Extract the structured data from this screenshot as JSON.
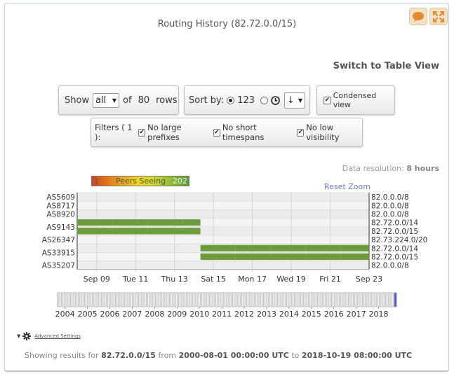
{
  "title": "Routing History (82.72.0.0/15)",
  "icons": {
    "comment": "speech-bubble-icon",
    "expand": "expand-icon",
    "gear": "gear-icon"
  },
  "switch_link": "Switch to Table View",
  "rows_control": {
    "show_label": "Show",
    "selected": "all",
    "of_label": "of",
    "count": "80",
    "rows_label": "rows"
  },
  "sort_control": {
    "label": "Sort by:",
    "numeric_label": "123",
    "selected": "123",
    "order": "↓"
  },
  "condensed": {
    "label": "Condensed view",
    "checked": true
  },
  "filters": {
    "label": "Filters ( 1 ):",
    "items": [
      {
        "label": "No large prefixes",
        "checked": true
      },
      {
        "label": "No short timespans",
        "checked": true
      },
      {
        "label": "No low visibility",
        "checked": true
      }
    ]
  },
  "resolution": {
    "label": "Data resolution:",
    "value": "8 hours"
  },
  "legend": {
    "min": "1",
    "label": "Peers Seeing",
    "max": "202"
  },
  "reset_zoom": "Reset Zoom",
  "chart_data": {
    "type": "timeline",
    "x_range": [
      "2018-09-08",
      "2018-09-23"
    ],
    "x_ticks": [
      {
        "date": "2018-09-09",
        "label": "Sep 09"
      },
      {
        "date": "2018-09-11",
        "label": "Tue 11"
      },
      {
        "date": "2018-09-13",
        "label": "Thu 13"
      },
      {
        "date": "2018-09-15",
        "label": "Sat 15"
      },
      {
        "date": "2018-09-17",
        "label": "Mon 17"
      },
      {
        "date": "2018-09-19",
        "label": "Wed 19"
      },
      {
        "date": "2018-09-21",
        "label": "Fri 21"
      },
      {
        "date": "2018-09-23",
        "label": "Sep 23"
      }
    ],
    "as_labels": [
      {
        "label": "AS5609",
        "rows": [
          0
        ]
      },
      {
        "label": "AS8717",
        "rows": [
          1
        ]
      },
      {
        "label": "AS8920",
        "rows": [
          2
        ]
      },
      {
        "label": "AS9143",
        "rows": [
          3,
          4
        ]
      },
      {
        "label": "AS26347",
        "rows": [
          5
        ]
      },
      {
        "label": "AS33915",
        "rows": [
          6,
          7
        ]
      },
      {
        "label": "AS35207",
        "rows": [
          8
        ]
      }
    ],
    "prefixes": [
      "82.0.0.0/8",
      "82.0.0.0/8",
      "82.0.0.0/8",
      "82.72.0.0/14",
      "82.72.0.0/15",
      "82.73.224.0/20",
      "82.72.0.0/14",
      "82.72.0.0/15",
      "82.0.0.0/8"
    ],
    "bars": [
      {
        "row": 3,
        "start": "2018-09-08T00:00",
        "end": "2018-09-14T08:00",
        "color": "#6c9c3c"
      },
      {
        "row": 4,
        "start": "2018-09-08T00:00",
        "end": "2018-09-14T08:00",
        "color": "#6c9c3c"
      },
      {
        "row": 6,
        "start": "2018-09-14T08:00",
        "end": "2018-09-23T00:00",
        "color": "#6c9c3c"
      },
      {
        "row": 7,
        "start": "2018-09-14T08:00",
        "end": "2018-09-23T00:00",
        "color": "#6c9c3c"
      }
    ],
    "navigator": {
      "years": [
        "2004",
        "2005",
        "2006",
        "2007",
        "2008",
        "2009",
        "2010",
        "2011",
        "2012",
        "2013",
        "2014",
        "2015",
        "2016",
        "2017",
        "2018"
      ],
      "range": [
        "2003-09-01",
        "2018-10-19"
      ]
    }
  },
  "advanced_settings": "Advanced Settings",
  "footer": {
    "prefix": "Showing results for",
    "resource": "82.72.0.0/15",
    "from_label": "from",
    "from": "2000-08-01 00:00:00 UTC",
    "to_label": "to",
    "to": "2018-10-19 08:00:00 UTC"
  }
}
